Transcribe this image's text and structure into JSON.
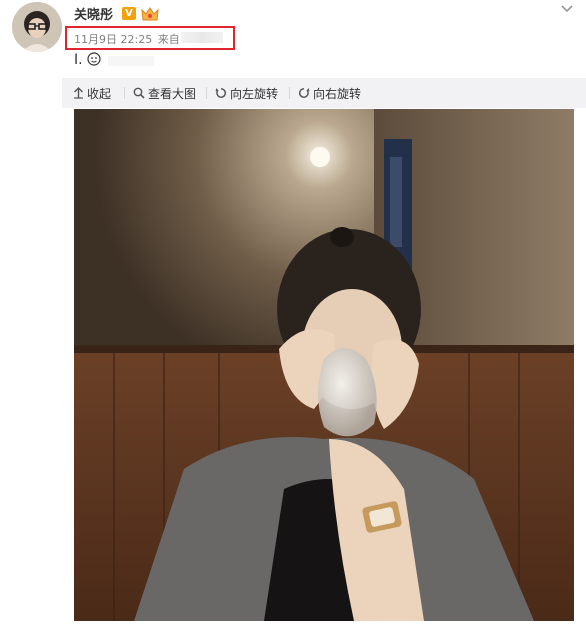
{
  "post": {
    "username": "关晓彤",
    "verified_badge": "V",
    "timestamp": "11月9日 22:25",
    "source_prefix": "来自",
    "source_fragment": "   ",
    "text": "I."
  },
  "toolbar": {
    "collapse_label": "收起",
    "view_large_label": "查看大图",
    "rotate_left_label": "向左旋转",
    "rotate_right_label": "向右旋转"
  },
  "colors": {
    "highlight_box": "#e0262c",
    "verified_badge": "#f1a30c",
    "toolbar_bg": "#f2f2f5",
    "meta_text": "#808080"
  },
  "icons": {
    "dropdown": "chevron-down-icon",
    "collapse": "arrow-up-icon",
    "view_large": "search-icon",
    "rotate_left": "rotate-left-icon",
    "rotate_right": "rotate-right-icon",
    "vip": "crown-icon",
    "emoji": "emoji-face-icon"
  }
}
